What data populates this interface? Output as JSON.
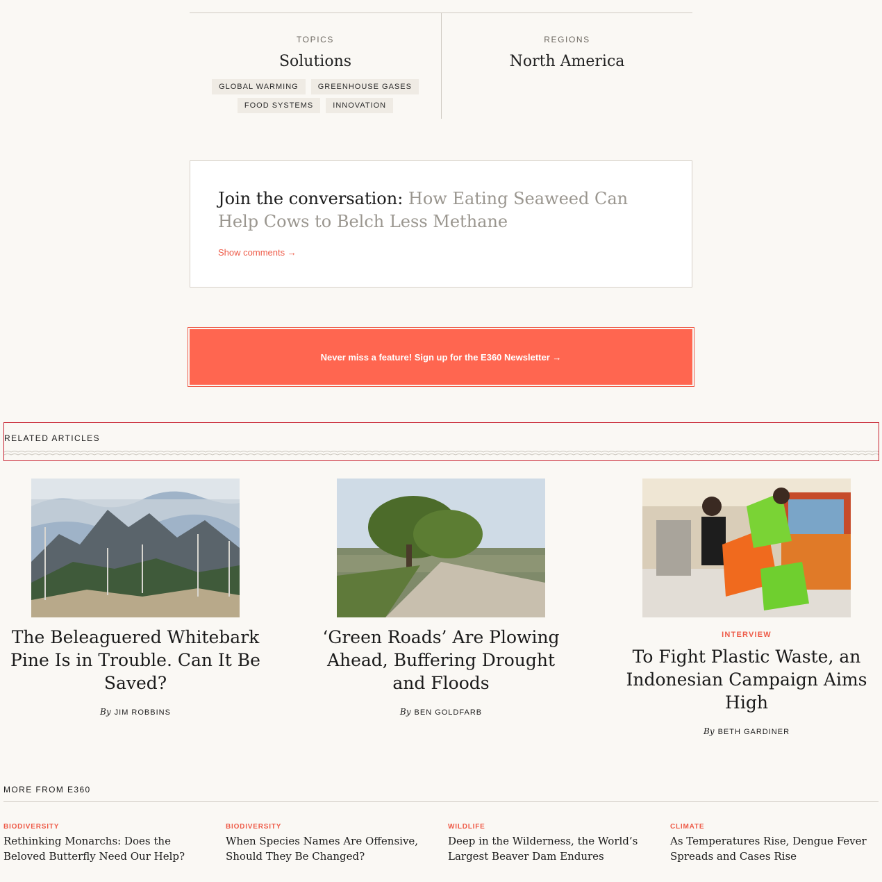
{
  "taxonomy": {
    "topics_label": "TOPICS",
    "topics_title": "Solutions",
    "tags": [
      "GLOBAL WARMING",
      "GREENHOUSE GASES",
      "FOOD SYSTEMS",
      "INNOVATION"
    ],
    "regions_label": "REGIONS",
    "regions_title": "North America"
  },
  "conversation": {
    "prefix": "Join the conversation: ",
    "link": "How Eating Seaweed Can Help Cows to Belch Less Methane",
    "show_comments": "Show comments →"
  },
  "newsletter": {
    "label": "Never miss a feature! Sign up for the E360 Newsletter →"
  },
  "related": {
    "heading": "RELATED ARTICLES",
    "articles": [
      {
        "kicker": "",
        "title": "The Beleaguered Whitebark Pine Is in Trouble. Can It Be Saved?",
        "by": "By",
        "author": "JIM ROBBINS"
      },
      {
        "kicker": "",
        "title": "‘Green Roads’ Are Plowing Ahead, Buffering Drought and Floods",
        "by": "By",
        "author": "BEN GOLDFARB"
      },
      {
        "kicker": "INTERVIEW",
        "title": "To Fight Plastic Waste, an Indonesian Campaign Aims High",
        "by": "By",
        "author": "BETH GARDINER"
      }
    ]
  },
  "more": {
    "heading": "MORE FROM E360",
    "items": [
      {
        "category": "BIODIVERSITY",
        "title": "Rethinking Monarchs: Does the Beloved Butterfly Need Our Help?"
      },
      {
        "category": "BIODIVERSITY",
        "title": "When Species Names Are Offensive, Should They Be Changed?"
      },
      {
        "category": "WILDLIFE",
        "title": "Deep in the Wilderness, the World’s Largest Beaver Dam Endures"
      },
      {
        "category": "CLIMATE",
        "title": "As Temperatures Rise, Dengue Fever Spreads and Cases Rise"
      }
    ]
  },
  "colors": {
    "accent": "#ff6650",
    "background": "#faf8f4"
  }
}
